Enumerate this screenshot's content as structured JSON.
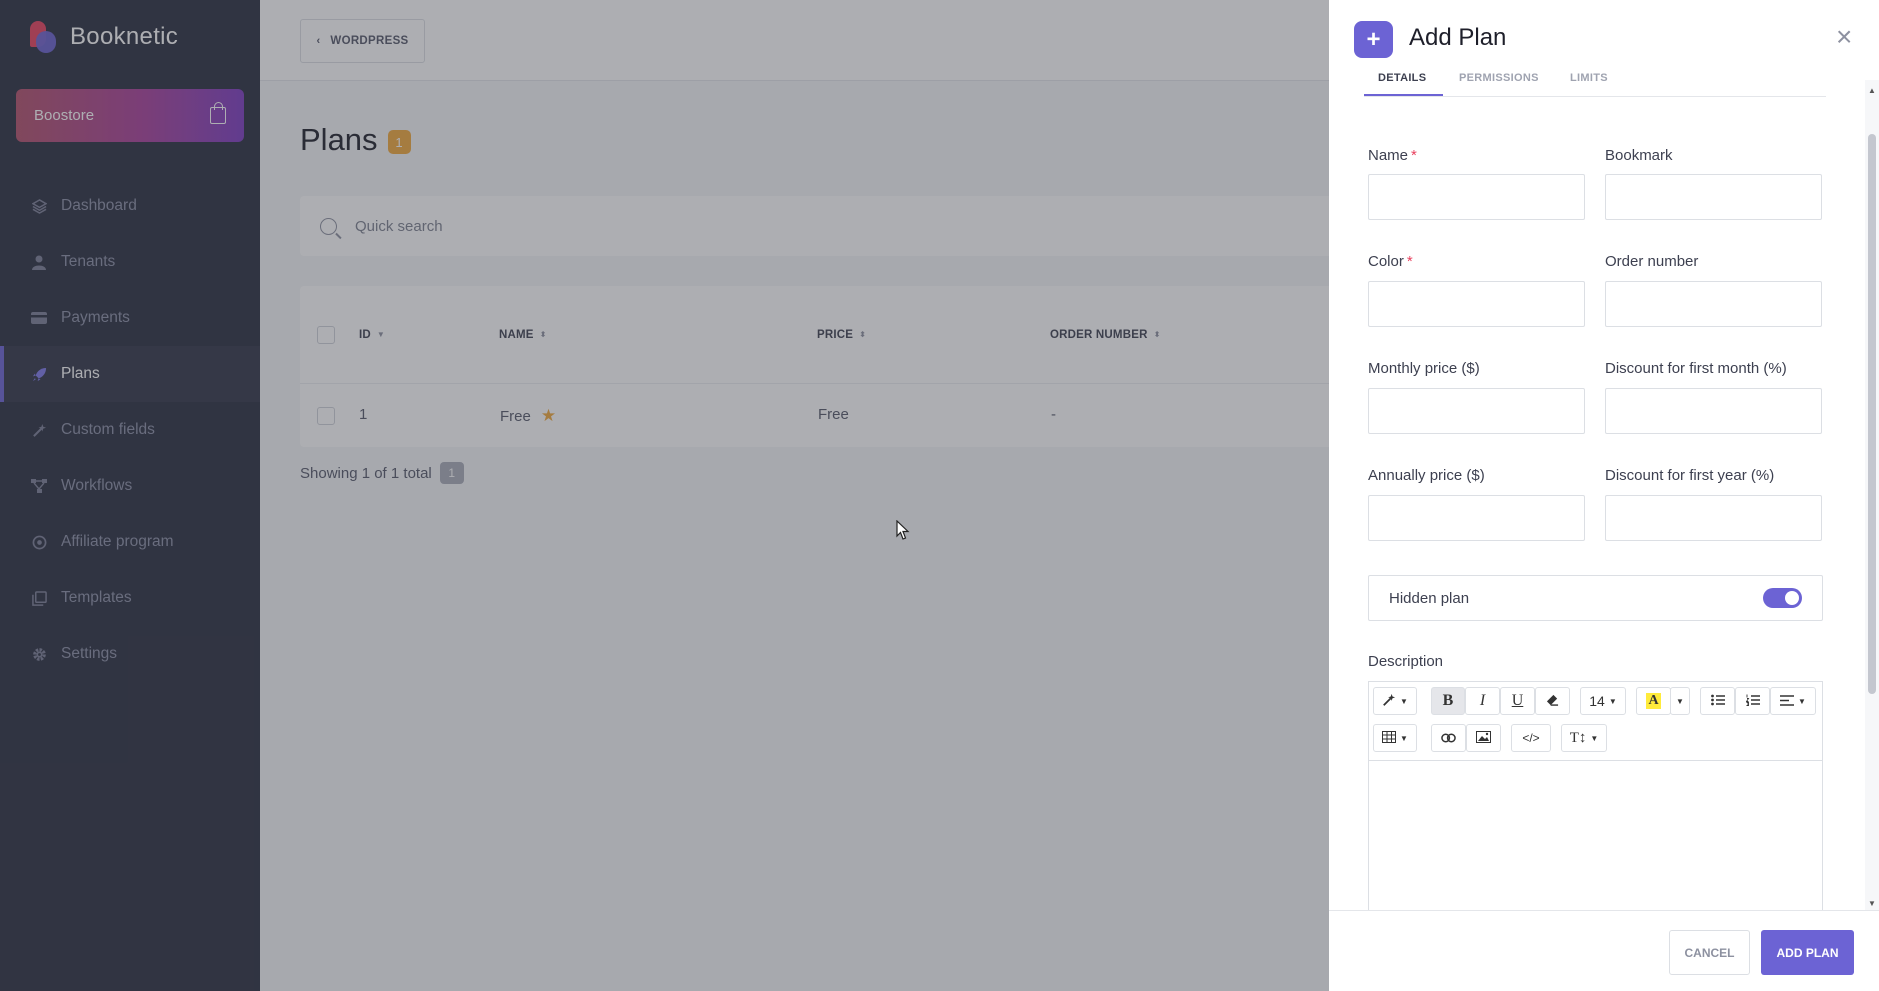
{
  "app": {
    "name": "Booknetic",
    "store_label": "Boostore"
  },
  "sidebar": {
    "items": [
      {
        "label": "Dashboard",
        "icon": "dashboard-icon"
      },
      {
        "label": "Tenants",
        "icon": "user-icon"
      },
      {
        "label": "Payments",
        "icon": "card-icon"
      },
      {
        "label": "Plans",
        "icon": "rocket-icon",
        "active": true
      },
      {
        "label": "Custom fields",
        "icon": "magic-icon"
      },
      {
        "label": "Workflows",
        "icon": "workflow-icon"
      },
      {
        "label": "Affiliate program",
        "icon": "target-icon"
      },
      {
        "label": "Templates",
        "icon": "copy-icon"
      },
      {
        "label": "Settings",
        "icon": "gear-icon"
      }
    ]
  },
  "topbar": {
    "back_label": "WORDPRESS"
  },
  "page": {
    "title": "Plans",
    "count": "1",
    "search_placeholder": "Quick search",
    "columns": [
      "ID",
      "NAME",
      "PRICE",
      "ORDER NUMBER"
    ],
    "rows": [
      {
        "id": "1",
        "name": "Free",
        "price": "Free",
        "order": "-"
      }
    ],
    "showing_text": "Showing 1 of 1 total",
    "showing_count": "1"
  },
  "drawer": {
    "title": "Add Plan",
    "tabs": [
      "DETAILS",
      "PERMISSIONS",
      "LIMITS"
    ],
    "fields": {
      "name": "Name",
      "bookmark": "Bookmark",
      "color": "Color",
      "order_number": "Order number",
      "monthly_price": "Monthly price ($)",
      "discount_first_month": "Discount for first month (%)",
      "annually_price": "Annually price ($)",
      "discount_first_year": "Discount for first year (%)",
      "required_mark": "*"
    },
    "hidden_plan_label": "Hidden plan",
    "hidden_plan_on": true,
    "description_label": "Description",
    "editor": {
      "font_size": "14"
    },
    "cancel_label": "CANCEL",
    "submit_label": "ADD PLAN"
  },
  "colors": {
    "accent": "#6c63d4",
    "sidebar": "#292d3e",
    "badge": "#f2a93b",
    "required": "#e8415e"
  }
}
